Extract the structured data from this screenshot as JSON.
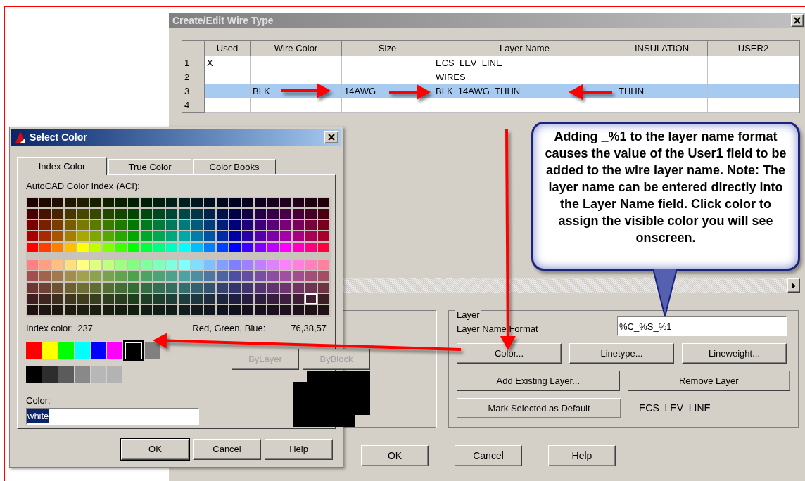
{
  "main_window": {
    "title": "Create/Edit Wire Type"
  },
  "table": {
    "columns": [
      "Used",
      "Wire Color",
      "Size",
      "Layer Name",
      "INSULATION",
      "USER2"
    ],
    "rows": [
      {
        "number": "1",
        "used": "X",
        "layer_name": "ECS_LEV_LINE",
        "selected": false
      },
      {
        "number": "2",
        "layer_name": "WIRES",
        "selected": false
      },
      {
        "number": "3",
        "wire_color": "BLK",
        "size": "14AWG",
        "layer_name": "BLK_14AWG_THHN",
        "insulation": "THHN",
        "selected": true
      },
      {
        "number": "4",
        "selected": false
      }
    ]
  },
  "layer_group": {
    "legend": "Layer",
    "format_label": "Layer Name Format",
    "format_value": "%C_%S_%1",
    "button_rows": [
      [
        "Color...",
        "Linetype...",
        "Lineweight..."
      ],
      [
        "Add Existing Layer...",
        "Remove Layer"
      ]
    ],
    "default_button": "Mark Selected as Default",
    "default_layer": "ECS_LEV_LINE"
  },
  "dialog_buttons": [
    "OK",
    "Cancel",
    "Help"
  ],
  "select_color": {
    "title": "Select Color",
    "tabs": [
      {
        "label": "Index Color",
        "selected": true
      },
      {
        "label": "True Color",
        "selected": false
      },
      {
        "label": "Color Books",
        "selected": false
      }
    ],
    "palette_label": "AutoCAD Color Index (ACI):",
    "index_label": "Index color:",
    "index_value": "237",
    "rgb_label": "Red, Green, Blue:",
    "rgb_value": "76,38,57",
    "standard_colors": [
      {
        "color": "#ff0000",
        "selected": false
      },
      {
        "color": "#ffff00",
        "selected": false
      },
      {
        "color": "#00ff00",
        "selected": false
      },
      {
        "color": "#00ffff",
        "selected": false
      },
      {
        "color": "#0000ff",
        "selected": false
      },
      {
        "color": "#ff00ff",
        "selected": false
      },
      {
        "color": "#000000",
        "selected": true
      },
      {
        "color": "#808080",
        "selected": false
      }
    ],
    "grays": [
      {
        "color": "#000000",
        "selected": false
      },
      {
        "color": "#2d2d2d",
        "selected": false
      },
      {
        "color": "#5b5b5b",
        "selected": false
      },
      {
        "color": "#898989",
        "selected": false
      },
      {
        "color": "#b7b7b7",
        "selected": false
      },
      {
        "color": "#b3b3b3",
        "selected": false
      }
    ],
    "special_buttons": [
      {
        "label": "ByLayer",
        "disabled": true
      },
      {
        "label": "ByBlock",
        "disabled": true
      }
    ],
    "color_label": "Color:",
    "color_value": "white",
    "buttons": [
      "OK",
      "Cancel",
      "Help"
    ]
  },
  "callout": {
    "text": "Adding _%1 to the layer name format causes the value of the User1 field to be added to the wire layer name.  Note: The layer name can be entered directly into the Layer Name field.  Click color to assign the visible color you will see onscreen."
  }
}
